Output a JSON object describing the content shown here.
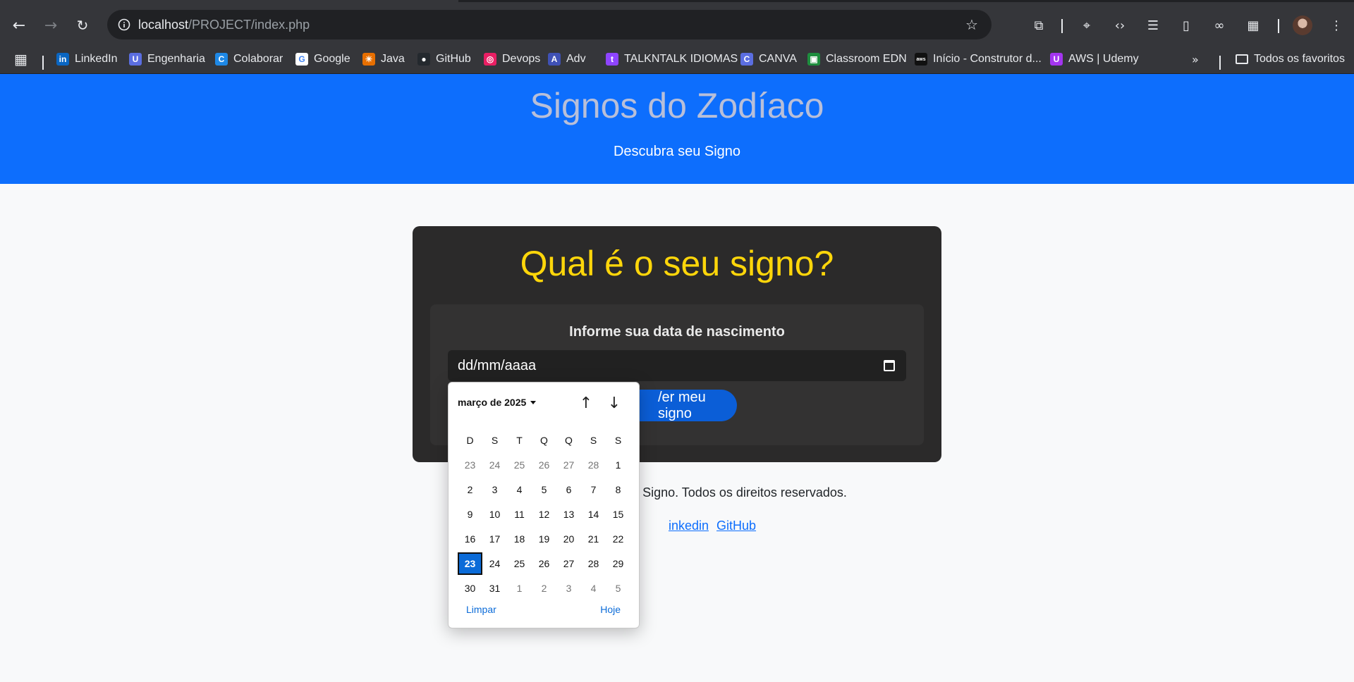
{
  "browser": {
    "url_host": "localhost",
    "url_path": "/PROJECT/index.php",
    "bookmarks": [
      {
        "label": "LinkedIn",
        "color": "#0a66c2",
        "glyph": "in"
      },
      {
        "label": "Engenharia",
        "color": "#5b6ee1",
        "glyph": "U"
      },
      {
        "label": "Colaborar",
        "color": "#1e88e5",
        "glyph": "C"
      },
      {
        "label": "Google",
        "color": "#ffffff",
        "glyph": "G"
      },
      {
        "label": "Java",
        "color": "#e76f00",
        "glyph": "☀"
      },
      {
        "label": "GitHub",
        "color": "#24292e",
        "glyph": "●"
      },
      {
        "label": "Devops",
        "color": "#e91e63",
        "glyph": "◎"
      },
      {
        "label": "Adv",
        "color": "#3f51b5",
        "glyph": "A"
      },
      {
        "label": "TALKNTALK IDIOMAS",
        "color": "#8e44ff",
        "glyph": "t"
      },
      {
        "label": "CANVA",
        "color": "#5b6ee1",
        "glyph": "C"
      },
      {
        "label": "Classroom EDN",
        "color": "#1e8e3e",
        "glyph": "▣"
      },
      {
        "label": "Início - Construtor d...",
        "color": "#111111",
        "glyph": "aws"
      },
      {
        "label": "AWS | Udemy",
        "color": "#a435f0",
        "glyph": "U"
      }
    ],
    "all_bookmarks_label": "Todos os favoritos"
  },
  "hero": {
    "title": "Signos do Zodíaco",
    "subtitle": "Descubra seu Signo"
  },
  "card": {
    "heading": "Qual é o seu signo?",
    "label": "Informe sua data de nascimento",
    "date_value": "dd/mm/aaaa",
    "button_label": "Ver meu signo",
    "button_visible_text": "/er meu signo"
  },
  "footer": {
    "text_visible": "Signo. Todos os direitos reservados.",
    "links": [
      "Linkedin",
      "GitHub"
    ],
    "linkedin_visible": "inkedin"
  },
  "datepicker": {
    "month_label": "março de 2025",
    "weekdays": [
      "D",
      "S",
      "T",
      "Q",
      "Q",
      "S",
      "S"
    ],
    "weeks": [
      [
        [
          "23",
          "other"
        ],
        [
          "24",
          "other"
        ],
        [
          "25",
          "other"
        ],
        [
          "26",
          "other"
        ],
        [
          "27",
          "other"
        ],
        [
          "28",
          "other"
        ],
        [
          "1",
          ""
        ]
      ],
      [
        [
          "2",
          ""
        ],
        [
          "3",
          ""
        ],
        [
          "4",
          ""
        ],
        [
          "5",
          ""
        ],
        [
          "6",
          ""
        ],
        [
          "7",
          ""
        ],
        [
          "8",
          ""
        ]
      ],
      [
        [
          "9",
          ""
        ],
        [
          "10",
          ""
        ],
        [
          "11",
          ""
        ],
        [
          "12",
          ""
        ],
        [
          "13",
          ""
        ],
        [
          "14",
          ""
        ],
        [
          "15",
          ""
        ]
      ],
      [
        [
          "16",
          ""
        ],
        [
          "17",
          ""
        ],
        [
          "18",
          ""
        ],
        [
          "19",
          ""
        ],
        [
          "20",
          ""
        ],
        [
          "21",
          ""
        ],
        [
          "22",
          ""
        ]
      ],
      [
        [
          "23",
          "selected"
        ],
        [
          "24",
          ""
        ],
        [
          "25",
          ""
        ],
        [
          "26",
          ""
        ],
        [
          "27",
          ""
        ],
        [
          "28",
          ""
        ],
        [
          "29",
          ""
        ]
      ],
      [
        [
          "30",
          ""
        ],
        [
          "31",
          ""
        ],
        [
          "1",
          "other"
        ],
        [
          "2",
          "other"
        ],
        [
          "3",
          "other"
        ],
        [
          "4",
          "other"
        ],
        [
          "5",
          "other"
        ]
      ]
    ],
    "clear_label": "Limpar",
    "today_label": "Hoje"
  }
}
